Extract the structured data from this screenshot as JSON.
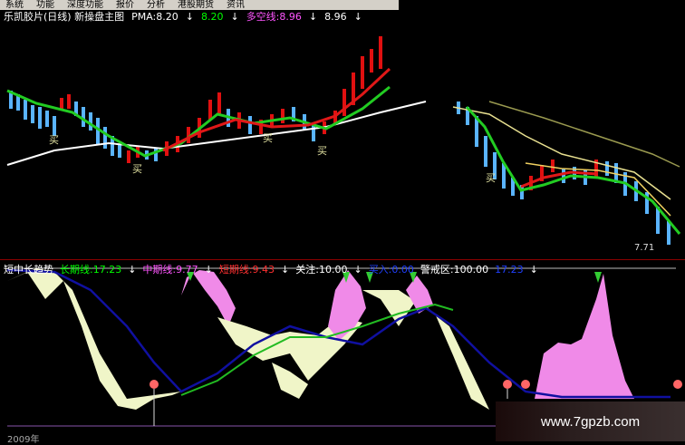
{
  "menu": [
    "系统",
    "功能",
    "深度功能",
    "报价",
    "分析",
    "港股期货",
    "资讯"
  ],
  "top_legend": {
    "title": "乐凯胶片(日线) 新操盘主图",
    "pma": "PMA:8.20",
    "pma2": "8.20",
    "duokong": "多空线:8.96",
    "val4": "8.96",
    "colors": {
      "pma": "#ffffff",
      "pma2": "#00ff00",
      "duokong": "#ff55ff",
      "val4": "#ffffff"
    }
  },
  "price_label": "7.71",
  "buy_marks": [
    "买",
    "买",
    "买",
    "买",
    "买"
  ],
  "bottom_legend": {
    "title": "短中长趋势",
    "long": "长期线:17.23",
    "mid": "中期线:9.77",
    "short": "短期线:9.43",
    "focus": "关注:10.00",
    "buyin": "买入:0.00",
    "alert": "警戒区:100.00",
    "last": "17.23",
    "colors": {
      "long": "#00ff00",
      "mid": "#ff55ff",
      "short": "#ff3030",
      "focus": "#ffffff",
      "buyin": "#2040ff",
      "alert": "#ffffff",
      "last": "#2040ff"
    }
  },
  "year_label": "2009年",
  "watermark": "www.7gpzb.com"
}
